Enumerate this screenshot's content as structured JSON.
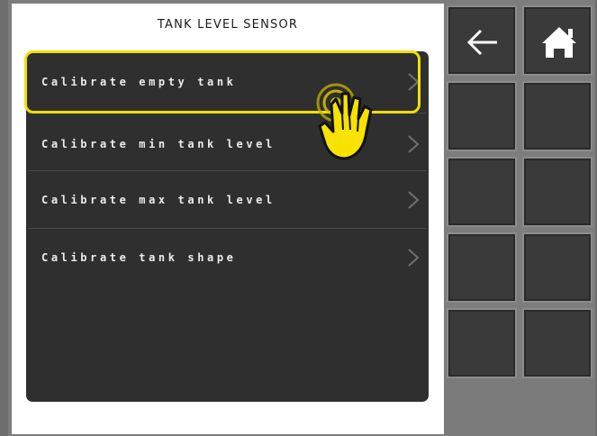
{
  "header": {
    "title": "TANK LEVEL SENSOR"
  },
  "menu": {
    "items": [
      {
        "label": "Calibrate empty tank"
      },
      {
        "label": "Calibrate min tank level"
      },
      {
        "label": "Calibrate max tank level"
      },
      {
        "label": "Calibrate tank shape"
      }
    ],
    "selected_index": 0
  },
  "sidebar": {
    "buttons": [
      {
        "icon": "back-arrow-icon"
      },
      {
        "icon": "home-icon"
      }
    ],
    "blank_button_rows": 4
  },
  "colors": {
    "highlight": "#f0e000",
    "card_background": "#2f2f2f",
    "button_background": "#3a3a3a"
  }
}
